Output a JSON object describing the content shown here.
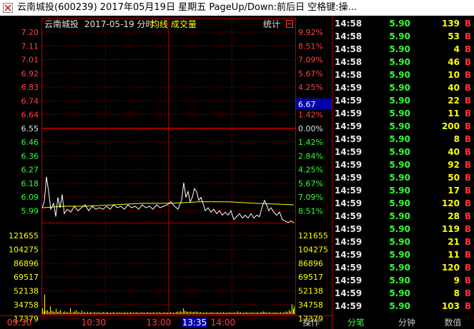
{
  "window": {
    "title": "云南城投(600239) 2017年05月19日 星期五 PageUp/Down:前后日 空格键:操..."
  },
  "chart_header": {
    "stock_name": "云南城投",
    "date_label": "2017-05-19 分时",
    "avg_label": "均线",
    "volume_label": "成交量",
    "stats_label": "统计"
  },
  "chart_data": {
    "type": "line",
    "price_ticks": [
      "7.20",
      "7.11",
      "7.01",
      "6.92",
      "6.83",
      "6.74",
      "6.64",
      "6.55",
      "6.46",
      "6.36",
      "6.27",
      "6.18",
      "6.09",
      "5.99"
    ],
    "pct_ticks": [
      "9.92%",
      "8.51%",
      "7.09%",
      "5.67%",
      "4.25%",
      "2.84%",
      "1.42%",
      "0.00%",
      "1.42%",
      "2.84%",
      "4.25%",
      "5.67%",
      "7.09%",
      "8.51%"
    ],
    "volume_ticks": [
      "121655",
      "104275",
      "86896",
      "69517",
      "52138",
      "34758",
      "17379"
    ],
    "time_ticks": [
      "09:30",
      "10:30",
      "13:00",
      "13:35",
      "14:00"
    ],
    "cursor_price_label": "6.67",
    "highlighted_time": "13:35",
    "ylim": [
      5.9,
      7.2
    ],
    "price_series": [
      [
        0,
        6.01
      ],
      [
        3,
        6.05
      ],
      [
        6,
        6.22
      ],
      [
        9,
        6.12
      ],
      [
        12,
        6.0
      ],
      [
        16,
        6.04
      ],
      [
        19,
        5.95
      ],
      [
        22,
        6.08
      ],
      [
        25,
        6.01
      ],
      [
        28,
        6.1
      ],
      [
        31,
        5.97
      ],
      [
        35,
        6.0
      ],
      [
        40,
        5.98
      ],
      [
        45,
        6.02
      ],
      [
        50,
        5.99
      ],
      [
        55,
        6.01
      ],
      [
        60,
        6.03
      ],
      [
        65,
        5.99
      ],
      [
        70,
        6.02
      ],
      [
        75,
        6.0
      ],
      [
        80,
        6.01
      ],
      [
        85,
        6.0
      ],
      [
        90,
        6.02
      ],
      [
        95,
        6.0
      ],
      [
        100,
        6.03
      ],
      [
        105,
        6.01
      ],
      [
        110,
        6.02
      ],
      [
        115,
        6.0
      ],
      [
        120,
        6.03
      ],
      [
        125,
        6.01
      ],
      [
        130,
        6.02
      ],
      [
        135,
        6.0
      ],
      [
        140,
        6.03
      ],
      [
        145,
        6.01
      ],
      [
        150,
        6.02
      ],
      [
        155,
        6.0
      ],
      [
        160,
        6.03
      ],
      [
        165,
        6.01
      ],
      [
        170,
        6.02
      ],
      [
        175,
        6.03
      ],
      [
        180,
        6.05
      ],
      [
        185,
        6.02
      ],
      [
        190,
        6.0
      ],
      [
        195,
        6.06
      ],
      [
        198,
        6.18
      ],
      [
        201,
        6.08
      ],
      [
        204,
        6.12
      ],
      [
        207,
        6.05
      ],
      [
        210,
        6.08
      ],
      [
        213,
        6.14
      ],
      [
        216,
        6.12
      ],
      [
        219,
        6.06
      ],
      [
        222,
        6.08
      ],
      [
        225,
        6.04
      ],
      [
        228,
        5.99
      ],
      [
        232,
        6.01
      ],
      [
        236,
        5.98
      ],
      [
        240,
        6.0
      ],
      [
        244,
        5.97
      ],
      [
        248,
        5.99
      ],
      [
        252,
        5.96
      ],
      [
        256,
        5.98
      ],
      [
        260,
        5.96
      ],
      [
        264,
        5.99
      ],
      [
        268,
        5.93
      ],
      [
        272,
        5.95
      ],
      [
        276,
        5.97
      ],
      [
        280,
        5.94
      ],
      [
        284,
        5.96
      ],
      [
        288,
        5.94
      ],
      [
        292,
        5.97
      ],
      [
        296,
        5.94
      ],
      [
        300,
        5.96
      ],
      [
        304,
        5.95
      ],
      [
        308,
        6.02
      ],
      [
        311,
        6.06
      ],
      [
        314,
        6.03
      ],
      [
        317,
        5.99
      ],
      [
        320,
        6.01
      ],
      [
        324,
        5.98
      ],
      [
        328,
        5.96
      ],
      [
        332,
        5.98
      ],
      [
        336,
        5.93
      ],
      [
        340,
        5.92
      ],
      [
        344,
        5.91
      ],
      [
        348,
        5.92
      ],
      [
        352,
        5.91
      ]
    ],
    "avg_series": [
      [
        0,
        6.01
      ],
      [
        30,
        6.02
      ],
      [
        60,
        6.02
      ],
      [
        100,
        6.03
      ],
      [
        140,
        6.04
      ],
      [
        180,
        6.04
      ],
      [
        220,
        6.05
      ],
      [
        260,
        6.05
      ],
      [
        300,
        6.04
      ],
      [
        352,
        6.03
      ]
    ],
    "volume_series": [
      [
        0,
        9000
      ],
      [
        2,
        4000
      ],
      [
        3,
        30000
      ],
      [
        5,
        5000
      ],
      [
        7,
        6000
      ],
      [
        9,
        3000
      ],
      [
        11,
        12000
      ],
      [
        13,
        5000
      ],
      [
        15,
        4000
      ],
      [
        17,
        3000
      ],
      [
        19,
        8000
      ],
      [
        21,
        3000
      ],
      [
        23,
        4000
      ],
      [
        25,
        6000
      ],
      [
        27,
        2000
      ],
      [
        29,
        3000
      ],
      [
        31,
        4000
      ],
      [
        33,
        2500
      ],
      [
        35,
        3000
      ],
      [
        37,
        2000
      ],
      [
        39,
        9000
      ],
      [
        41,
        2000
      ],
      [
        43,
        3000
      ],
      [
        45,
        4000
      ],
      [
        47,
        6000
      ],
      [
        49,
        2500
      ],
      [
        51,
        3000
      ],
      [
        53,
        2000
      ],
      [
        55,
        5000
      ],
      [
        57,
        2500
      ],
      [
        59,
        3000
      ],
      [
        61,
        2000
      ],
      [
        63,
        3500
      ],
      [
        65,
        2000
      ],
      [
        67,
        3000
      ],
      [
        69,
        2500
      ],
      [
        71,
        2000
      ],
      [
        73,
        3000
      ],
      [
        75,
        2500
      ],
      [
        77,
        2000
      ],
      [
        79,
        3000
      ],
      [
        81,
        2000
      ],
      [
        83,
        2500
      ],
      [
        85,
        3000
      ],
      [
        87,
        2000
      ],
      [
        89,
        2500
      ],
      [
        91,
        3000
      ],
      [
        93,
        2000
      ],
      [
        95,
        2500
      ],
      [
        97,
        2000
      ],
      [
        99,
        3000
      ],
      [
        101,
        2000
      ],
      [
        103,
        2500
      ],
      [
        105,
        2000
      ],
      [
        107,
        3000
      ],
      [
        109,
        2000
      ],
      [
        111,
        2500
      ],
      [
        113,
        2000
      ],
      [
        115,
        3000
      ],
      [
        117,
        2000
      ],
      [
        119,
        2500
      ],
      [
        121,
        2000
      ],
      [
        123,
        3000
      ],
      [
        125,
        2000
      ],
      [
        127,
        2500
      ],
      [
        129,
        2000
      ],
      [
        131,
        3000
      ],
      [
        133,
        2000
      ],
      [
        135,
        2500
      ],
      [
        137,
        2000
      ],
      [
        139,
        3000
      ],
      [
        141,
        2000
      ],
      [
        143,
        2500
      ],
      [
        145,
        2000
      ],
      [
        147,
        3000
      ],
      [
        149,
        2000
      ],
      [
        151,
        2500
      ],
      [
        153,
        2000
      ],
      [
        155,
        3000
      ],
      [
        157,
        2000
      ],
      [
        159,
        2500
      ],
      [
        161,
        2000
      ],
      [
        163,
        3000
      ],
      [
        165,
        2000
      ],
      [
        167,
        2500
      ],
      [
        169,
        2000
      ],
      [
        171,
        3000
      ],
      [
        173,
        2000
      ],
      [
        175,
        2500
      ],
      [
        177,
        2000
      ],
      [
        179,
        3000
      ],
      [
        181,
        2000
      ],
      [
        183,
        2500
      ],
      [
        185,
        2000
      ],
      [
        187,
        3000
      ],
      [
        189,
        4000
      ],
      [
        191,
        3000
      ],
      [
        193,
        4500
      ],
      [
        195,
        3000
      ],
      [
        197,
        9000
      ],
      [
        199,
        5000
      ],
      [
        201,
        4000
      ],
      [
        203,
        3500
      ],
      [
        205,
        3000
      ],
      [
        207,
        4000
      ],
      [
        209,
        3000
      ],
      [
        211,
        3500
      ],
      [
        213,
        3000
      ],
      [
        215,
        4000
      ],
      [
        217,
        3000
      ],
      [
        219,
        2500
      ],
      [
        221,
        3000
      ],
      [
        223,
        2000
      ],
      [
        225,
        2500
      ],
      [
        227,
        2000
      ],
      [
        229,
        3000
      ],
      [
        231,
        2000
      ],
      [
        233,
        2500
      ],
      [
        235,
        2000
      ],
      [
        237,
        3000
      ],
      [
        239,
        2000
      ],
      [
        241,
        2500
      ],
      [
        243,
        2000
      ],
      [
        245,
        3000
      ],
      [
        247,
        2000
      ],
      [
        249,
        2500
      ],
      [
        251,
        2000
      ],
      [
        253,
        3000
      ],
      [
        255,
        2000
      ],
      [
        257,
        2500
      ],
      [
        259,
        2000
      ],
      [
        261,
        3000
      ],
      [
        263,
        2000
      ],
      [
        265,
        2500
      ],
      [
        267,
        2000
      ],
      [
        269,
        3000
      ],
      [
        271,
        2000
      ],
      [
        273,
        4000
      ],
      [
        275,
        2500
      ],
      [
        277,
        3000
      ],
      [
        279,
        2000
      ],
      [
        281,
        2500
      ],
      [
        283,
        2000
      ],
      [
        285,
        3000
      ],
      [
        287,
        2000
      ],
      [
        289,
        2500
      ],
      [
        291,
        2000
      ],
      [
        293,
        3000
      ],
      [
        295,
        2000
      ],
      [
        297,
        2500
      ],
      [
        299,
        2000
      ],
      [
        301,
        3000
      ],
      [
        303,
        2000
      ],
      [
        305,
        2500
      ],
      [
        307,
        3000
      ],
      [
        309,
        4000
      ],
      [
        311,
        3000
      ],
      [
        313,
        2500
      ],
      [
        315,
        2000
      ],
      [
        317,
        3000
      ],
      [
        319,
        2000
      ],
      [
        321,
        2500
      ],
      [
        323,
        2000
      ],
      [
        325,
        3000
      ],
      [
        327,
        2000
      ],
      [
        329,
        2500
      ],
      [
        331,
        2000
      ],
      [
        333,
        3000
      ],
      [
        335,
        2000
      ],
      [
        337,
        2500
      ],
      [
        339,
        3000
      ],
      [
        341,
        4000
      ],
      [
        343,
        3000
      ],
      [
        345,
        6000
      ],
      [
        347,
        4000
      ],
      [
        349,
        15000
      ],
      [
        351,
        8000
      ],
      [
        352,
        12000
      ]
    ]
  },
  "ticks": {
    "columns": [
      "time",
      "price",
      "volume",
      "side"
    ],
    "rows": [
      [
        "14:58",
        "5.90",
        "139",
        "B"
      ],
      [
        "14:58",
        "5.90",
        "53",
        "B"
      ],
      [
        "14:58",
        "5.90",
        "4",
        "B"
      ],
      [
        "14:58",
        "5.90",
        "46",
        "B"
      ],
      [
        "14:58",
        "5.90",
        "10",
        "B"
      ],
      [
        "14:59",
        "5.90",
        "40",
        "B"
      ],
      [
        "14:59",
        "5.90",
        "22",
        "B"
      ],
      [
        "14:59",
        "5.90",
        "11",
        "B"
      ],
      [
        "14:59",
        "5.90",
        "200",
        "B"
      ],
      [
        "14:59",
        "5.90",
        "8",
        "B"
      ],
      [
        "14:59",
        "5.90",
        "40",
        "B"
      ],
      [
        "14:59",
        "5.90",
        "92",
        "B"
      ],
      [
        "14:59",
        "5.90",
        "50",
        "B"
      ],
      [
        "14:59",
        "5.90",
        "17",
        "B"
      ],
      [
        "14:59",
        "5.90",
        "120",
        "B"
      ],
      [
        "14:59",
        "5.90",
        "28",
        "B"
      ],
      [
        "14:59",
        "5.90",
        "119",
        "B"
      ],
      [
        "14:59",
        "5.90",
        "21",
        "B"
      ],
      [
        "14:59",
        "5.90",
        "11",
        "B"
      ],
      [
        "14:59",
        "5.90",
        "120",
        "B"
      ],
      [
        "14:59",
        "5.90",
        "9",
        "B"
      ],
      [
        "14:59",
        "5.90",
        "8",
        "B"
      ],
      [
        "14:59",
        "5.90",
        "103",
        "B"
      ]
    ]
  },
  "tabs": [
    {
      "label": "操作",
      "active": false
    },
    {
      "label": "分笔",
      "active": true
    },
    {
      "label": "分钟",
      "active": false
    },
    {
      "label": "数值",
      "active": false
    }
  ],
  "colors": {
    "background": "#000000",
    "grid": "#b00000",
    "price_line": "#ffffff",
    "avg_line": "#ffff00",
    "tick_price": "#33ff33",
    "tick_volume": "#ffff00",
    "tick_side": "#ff3030",
    "axis_text": "#ff4040",
    "cursor_label_bg": "#0000aa"
  }
}
